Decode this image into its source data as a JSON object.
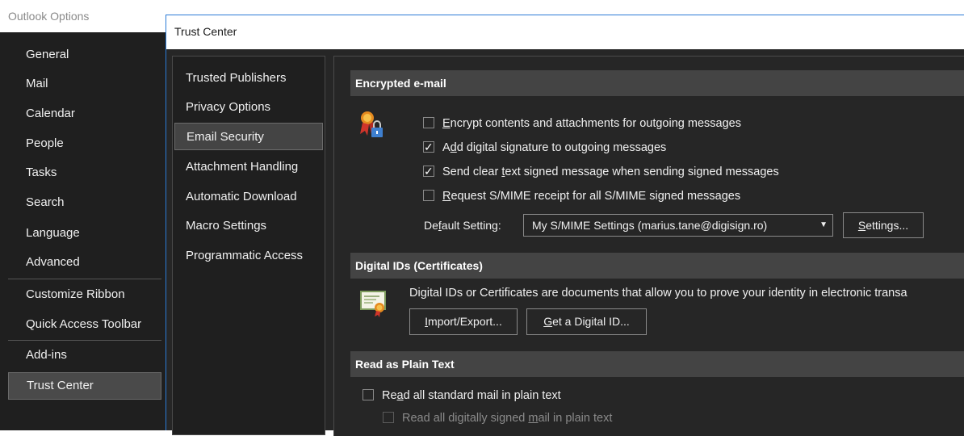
{
  "outer": {
    "title": "Outlook Options",
    "items": [
      {
        "label": "General"
      },
      {
        "label": "Mail"
      },
      {
        "label": "Calendar"
      },
      {
        "label": "People"
      },
      {
        "label": "Tasks"
      },
      {
        "label": "Search"
      },
      {
        "label": "Language"
      },
      {
        "label": "Advanced"
      },
      {
        "label": "Customize Ribbon"
      },
      {
        "label": "Quick Access Toolbar"
      },
      {
        "label": "Add-ins"
      },
      {
        "label": "Trust Center"
      }
    ],
    "selected": "Trust Center"
  },
  "trust_center": {
    "title": "Trust Center",
    "nav": [
      {
        "label": "Trusted Publishers"
      },
      {
        "label": "Privacy Options"
      },
      {
        "label": "Email Security"
      },
      {
        "label": "Attachment Handling"
      },
      {
        "label": "Automatic Download"
      },
      {
        "label": "Macro Settings"
      },
      {
        "label": "Programmatic Access"
      }
    ],
    "selected": "Email Security",
    "encrypted": {
      "header": "Encrypted e-mail",
      "icon": "certificate-lock-icon",
      "options": [
        {
          "pre": "",
          "key": "E",
          "post": "ncrypt contents and attachments for outgoing messages",
          "checked": false
        },
        {
          "pre": "A",
          "key": "d",
          "post": "d digital signature to outgoing messages",
          "checked": true
        },
        {
          "pre": "Send clear ",
          "key": "t",
          "post": "ext signed message when sending signed messages",
          "checked": true
        },
        {
          "pre": "",
          "key": "R",
          "post": "equest S/MIME receipt for all S/MIME signed messages",
          "checked": false
        }
      ],
      "default_setting_label_pre": "De",
      "default_setting_label_key": "f",
      "default_setting_label_post": "ault Setting:",
      "default_setting_value": "My S/MIME Settings (marius.tane@digisign.ro)",
      "settings_button_key": "S",
      "settings_button_post": "ettings..."
    },
    "digital_ids": {
      "header": "Digital IDs (Certificates)",
      "icon": "certificate-icon",
      "description": "Digital IDs or Certificates are documents that allow you to prove your identity in electronic transa",
      "import_key": "I",
      "import_post": "mport/Export...",
      "get_key": "G",
      "get_post": "et a Digital ID..."
    },
    "plain_text": {
      "header": "Read as Plain Text",
      "opt1_pre": "Re",
      "opt1_key": "a",
      "opt1_post": "d all standard mail in plain text",
      "opt1_checked": false,
      "opt2_pre": "Read all digitally signed ",
      "opt2_key": "m",
      "opt2_post": "ail in plain text",
      "opt2_checked": false
    }
  },
  "colors": {
    "dark_bg": "#262626",
    "nav_bg": "#1f1f1f",
    "header_bg": "#444444",
    "accent_border": "#2b7bd6"
  }
}
